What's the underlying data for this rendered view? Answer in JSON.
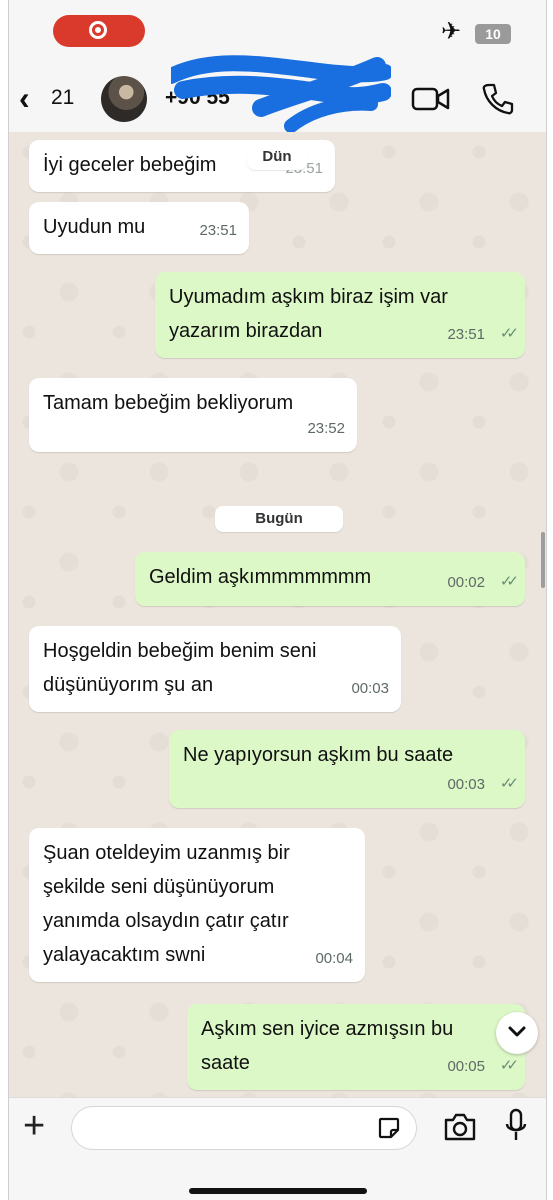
{
  "status_bar": {
    "battery": "10"
  },
  "header": {
    "back_count": "21",
    "contact_name": "+90 55",
    "icons": {
      "back": "chevron-left-icon",
      "video": "video-call-icon",
      "call": "phone-icon"
    }
  },
  "chat": {
    "messages": [
      {
        "dir": "in",
        "text": "İyi geceler bebeğim",
        "time": "23:51"
      },
      {
        "dir": "in",
        "text": "Uyudun mu",
        "time": "23:51"
      },
      {
        "dir": "out",
        "text": "Uyumadım aşkım biraz işim var\nyazarım birazdan",
        "time": "23:51"
      },
      {
        "dir": "in",
        "text": "Tamam bebeğim bekliyorum",
        "time": "23:52"
      },
      {
        "dir": "out",
        "text": "Geldim aşkımmmmmmm",
        "time": "00:02"
      },
      {
        "dir": "in",
        "text": "Hoşgeldin bebeğim benim seni\ndüşünüyorım şu an",
        "time": "00:03"
      },
      {
        "dir": "out",
        "text": "Ne yapıyorsun aşkım bu saate",
        "time": "00:03"
      },
      {
        "dir": "in",
        "text": "Şuan oteldeyim uzanmış bir\nşekilde seni düşünüyorum\nyanımda olsaydın çatır çatır\nyalayacaktım swni",
        "time": "00:04"
      },
      {
        "dir": "out",
        "text": "Aşkım sen iyice azmışsın bu\nsaate",
        "time": "00:05"
      }
    ],
    "date_yesterday": "Dün",
    "date_today": "Bugün",
    "read_ticks": "✓✓"
  },
  "input_bar": {
    "placeholder": ""
  },
  "colors": {
    "outgoing_bubble": "#dcf8c6",
    "incoming_bubble": "#ffffff",
    "chat_bg": "#ece5dd",
    "record_pill": "#d93a2b"
  }
}
